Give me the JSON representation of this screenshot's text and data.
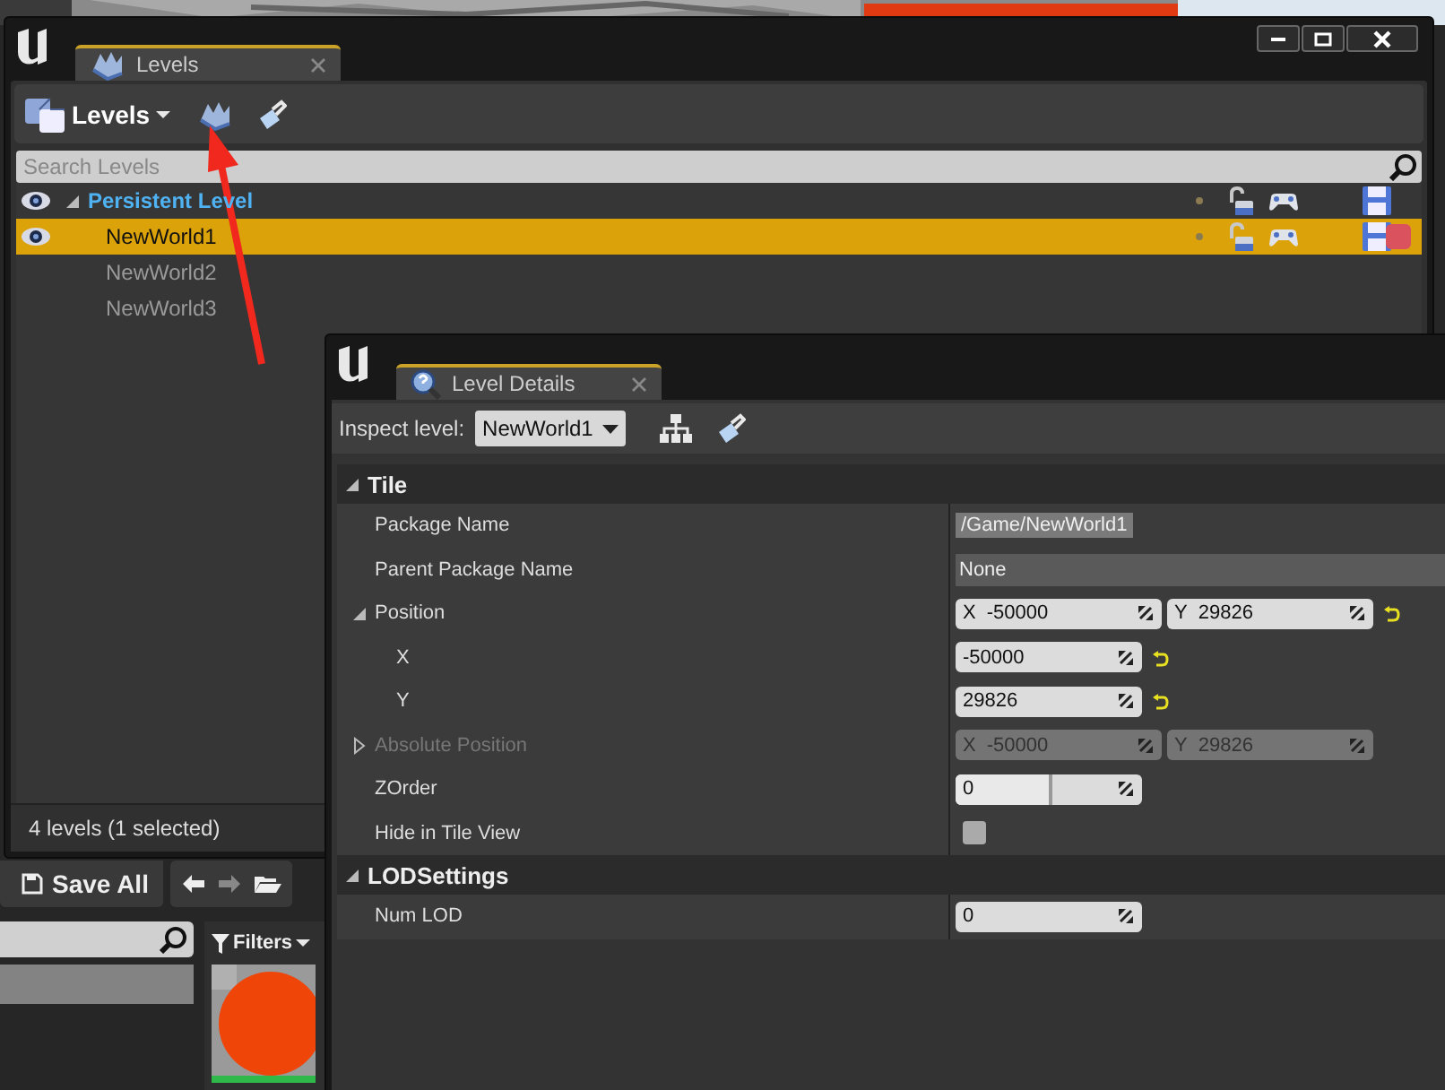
{
  "levels_window": {
    "tab": {
      "label": "Levels",
      "selected": true
    },
    "toolbar": {
      "menu": "Levels"
    },
    "search": {
      "placeholder": "Search Levels"
    },
    "levels": [
      {
        "name": "Persistent Level",
        "kind": "persistent",
        "loaded": true,
        "selected": false
      },
      {
        "name": "NewWorld1",
        "kind": "sublevel",
        "loaded": true,
        "selected": true,
        "color": "#d9525e"
      },
      {
        "name": "NewWorld2",
        "kind": "sublevel",
        "loaded": false,
        "selected": false
      },
      {
        "name": "NewWorld3",
        "kind": "sublevel",
        "loaded": false,
        "selected": false
      }
    ],
    "status": "4 levels (1 selected)"
  },
  "details_window": {
    "tab": {
      "label": "Level Details",
      "selected": true
    },
    "inspect_label": "Inspect level:",
    "inspect_value": "NewWorld1",
    "categories": [
      {
        "name": "Tile",
        "expanded": true,
        "properties": [
          {
            "name": "Package Name",
            "kind": "readonly",
            "value": "/Game/NewWorld1",
            "modified": false,
            "disabled": false
          },
          {
            "name": "Parent Package Name",
            "kind": "text",
            "value": "None",
            "modified": false,
            "disabled": false
          },
          {
            "name": "Position",
            "kind": "vector",
            "components": [
              {
                "axis": "X",
                "value": "-50000"
              },
              {
                "axis": "Y",
                "value": "29826"
              }
            ],
            "modified": true,
            "disabled": false,
            "expanded": true,
            "children": [
              {
                "name": "X",
                "kind": "number",
                "value": "-50000",
                "modified": true,
                "disabled": false
              },
              {
                "name": "Y",
                "kind": "number",
                "value": "29826",
                "modified": true,
                "disabled": false
              }
            ]
          },
          {
            "name": "Absolute Position",
            "kind": "vector",
            "components": [
              {
                "axis": "X",
                "value": "-50000"
              },
              {
                "axis": "Y",
                "value": "29826"
              }
            ],
            "modified": false,
            "disabled": true,
            "expanded": false
          },
          {
            "name": "ZOrder",
            "kind": "slider",
            "value": "0",
            "level": 0.5,
            "modified": false,
            "disabled": false
          },
          {
            "name": "Hide in Tile View",
            "kind": "checkbox",
            "checked": false,
            "modified": false,
            "disabled": false
          }
        ]
      },
      {
        "name": "LODSettings",
        "expanded": true,
        "properties": [
          {
            "name": "Num LOD",
            "kind": "number",
            "value": "0",
            "modified": false,
            "disabled": false
          }
        ]
      }
    ]
  },
  "editor": {
    "save_all": "Save All",
    "filters": "Filters"
  }
}
